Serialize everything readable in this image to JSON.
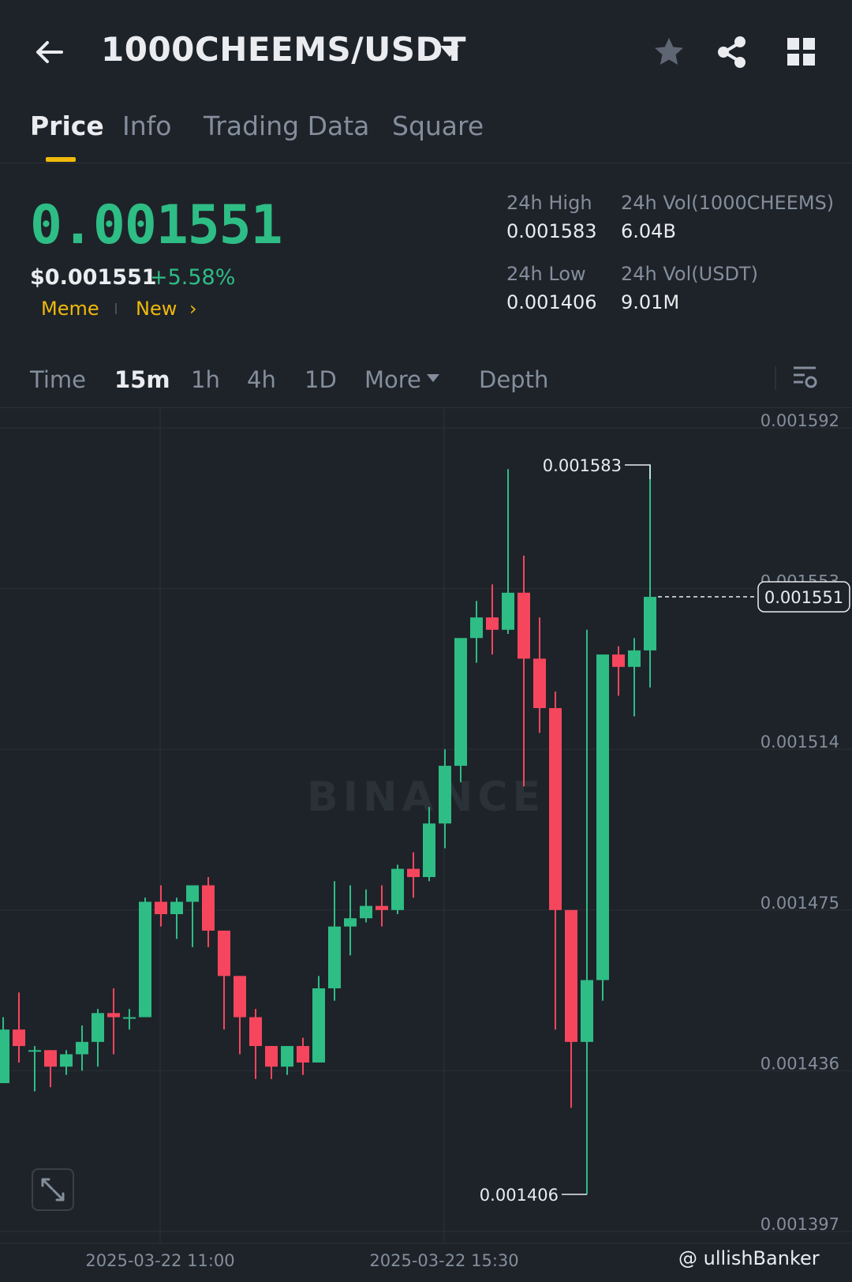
{
  "header": {
    "title": "1000CHEEMS/USDT"
  },
  "tabs": [
    {
      "label": "Price",
      "active": true
    },
    {
      "label": "Info"
    },
    {
      "label": "Trading Data"
    },
    {
      "label": "Square"
    }
  ],
  "price": {
    "last": "0.001551",
    "usd": "$0.001551",
    "change_pct": "+5.58%",
    "tags": [
      "Meme",
      "New"
    ]
  },
  "stats": {
    "high_label": "24h High",
    "high_value": "0.001583",
    "low_label": "24h Low",
    "low_value": "0.001406",
    "vol_base_label": "24h Vol(1000CHEEMS)",
    "vol_base_value": "6.04B",
    "vol_quote_label": "24h Vol(USDT)",
    "vol_quote_value": "9.01M"
  },
  "intervals": [
    {
      "label": "Time"
    },
    {
      "label": "15m",
      "active": true
    },
    {
      "label": "1h"
    },
    {
      "label": "4h"
    },
    {
      "label": "1D"
    },
    {
      "label": "More"
    },
    {
      "label": "Depth"
    }
  ],
  "colors": {
    "up": "#2ebd85",
    "down": "#f6465d",
    "accent": "#f0b90b",
    "background": "#1e2329"
  },
  "watermark": {
    "brand": "BINANCE",
    "handle": "@ ullishBanker"
  },
  "chart_data": {
    "type": "candlestick",
    "y_ticks": [
      "0.001592",
      "0.001553",
      "0.001514",
      "0.001475",
      "0.001436",
      "0.001397"
    ],
    "y_tick_values": [
      0.001592,
      0.001553,
      0.001514,
      0.001475,
      0.001436,
      0.001397
    ],
    "x_ticks": [
      "2025-03-22 11:00",
      "2025-03-22 15:30"
    ],
    "ylim": [
      0.001397,
      0.001592
    ],
    "high_marker": "0.001583",
    "low_marker": "0.001406",
    "current_price_label": "0.001551",
    "candles": [
      {
        "o": 0.001433,
        "h": 0.001449,
        "l": 0.001433,
        "c": 0.001446
      },
      {
        "o": 0.001446,
        "h": 0.001455,
        "l": 0.001438,
        "c": 0.001442
      },
      {
        "o": 0.001441,
        "h": 0.001442,
        "l": 0.001431,
        "c": 0.001441
      },
      {
        "o": 0.001441,
        "h": 0.001441,
        "l": 0.001432,
        "c": 0.001437
      },
      {
        "o": 0.001437,
        "h": 0.001441,
        "l": 0.001435,
        "c": 0.00144
      },
      {
        "o": 0.00144,
        "h": 0.001447,
        "l": 0.001436,
        "c": 0.001443
      },
      {
        "o": 0.001443,
        "h": 0.001451,
        "l": 0.001437,
        "c": 0.00145
      },
      {
        "o": 0.00145,
        "h": 0.001456,
        "l": 0.00144,
        "c": 0.001449
      },
      {
        "o": 0.001449,
        "h": 0.001451,
        "l": 0.001446,
        "c": 0.001449
      },
      {
        "o": 0.001449,
        "h": 0.001478,
        "l": 0.001449,
        "c": 0.001477
      },
      {
        "o": 0.001477,
        "h": 0.001481,
        "l": 0.001471,
        "c": 0.001474
      },
      {
        "o": 0.001474,
        "h": 0.001478,
        "l": 0.001468,
        "c": 0.001477
      },
      {
        "o": 0.001477,
        "h": 0.001478,
        "l": 0.001466,
        "c": 0.001481
      },
      {
        "o": 0.001481,
        "h": 0.001483,
        "l": 0.001466,
        "c": 0.00147
      },
      {
        "o": 0.00147,
        "h": 0.00147,
        "l": 0.001446,
        "c": 0.001459
      },
      {
        "o": 0.001459,
        "h": 0.001459,
        "l": 0.00144,
        "c": 0.001449
      },
      {
        "o": 0.001449,
        "h": 0.001451,
        "l": 0.001434,
        "c": 0.001442
      },
      {
        "o": 0.001442,
        "h": 0.001442,
        "l": 0.001434,
        "c": 0.001437
      },
      {
        "o": 0.001437,
        "h": 0.001442,
        "l": 0.001435,
        "c": 0.001442
      },
      {
        "o": 0.001442,
        "h": 0.001444,
        "l": 0.001435,
        "c": 0.001438
      },
      {
        "o": 0.001438,
        "h": 0.001459,
        "l": 0.001438,
        "c": 0.001456
      },
      {
        "o": 0.001456,
        "h": 0.001482,
        "l": 0.001453,
        "c": 0.001471
      },
      {
        "o": 0.001471,
        "h": 0.001481,
        "l": 0.001464,
        "c": 0.001473
      },
      {
        "o": 0.001473,
        "h": 0.00148,
        "l": 0.001472,
        "c": 0.001476
      },
      {
        "o": 0.001476,
        "h": 0.001481,
        "l": 0.001471,
        "c": 0.001475
      },
      {
        "o": 0.001475,
        "h": 0.001486,
        "l": 0.001474,
        "c": 0.001485
      },
      {
        "o": 0.001485,
        "h": 0.001489,
        "l": 0.001478,
        "c": 0.001483
      },
      {
        "o": 0.001483,
        "h": 0.0015,
        "l": 0.001482,
        "c": 0.001496
      },
      {
        "o": 0.001496,
        "h": 0.001514,
        "l": 0.00149,
        "c": 0.00151
      },
      {
        "o": 0.00151,
        "h": 0.001534,
        "l": 0.001506,
        "c": 0.001541
      },
      {
        "o": 0.001541,
        "h": 0.00155,
        "l": 0.001535,
        "c": 0.001546
      },
      {
        "o": 0.001546,
        "h": 0.001554,
        "l": 0.001537,
        "c": 0.001543
      },
      {
        "o": 0.001543,
        "h": 0.001582,
        "l": 0.001542,
        "c": 0.001552
      },
      {
        "o": 0.001552,
        "h": 0.001561,
        "l": 0.001505,
        "c": 0.001536
      },
      {
        "o": 0.001536,
        "h": 0.001546,
        "l": 0.001518,
        "c": 0.001524
      },
      {
        "o": 0.001524,
        "h": 0.001528,
        "l": 0.001446,
        "c": 0.001475
      },
      {
        "o": 0.001475,
        "h": 0.001475,
        "l": 0.001427,
        "c": 0.001443
      },
      {
        "o": 0.001443,
        "h": 0.001543,
        "l": 0.001406,
        "c": 0.001458
      },
      {
        "o": 0.001458,
        "h": 0.001515,
        "l": 0.001453,
        "c": 0.001537
      },
      {
        "o": 0.001537,
        "h": 0.001539,
        "l": 0.001527,
        "c": 0.001534
      },
      {
        "o": 0.001534,
        "h": 0.001541,
        "l": 0.001522,
        "c": 0.001538
      },
      {
        "o": 0.001538,
        "h": 0.001583,
        "l": 0.001529,
        "c": 0.001551
      }
    ]
  }
}
